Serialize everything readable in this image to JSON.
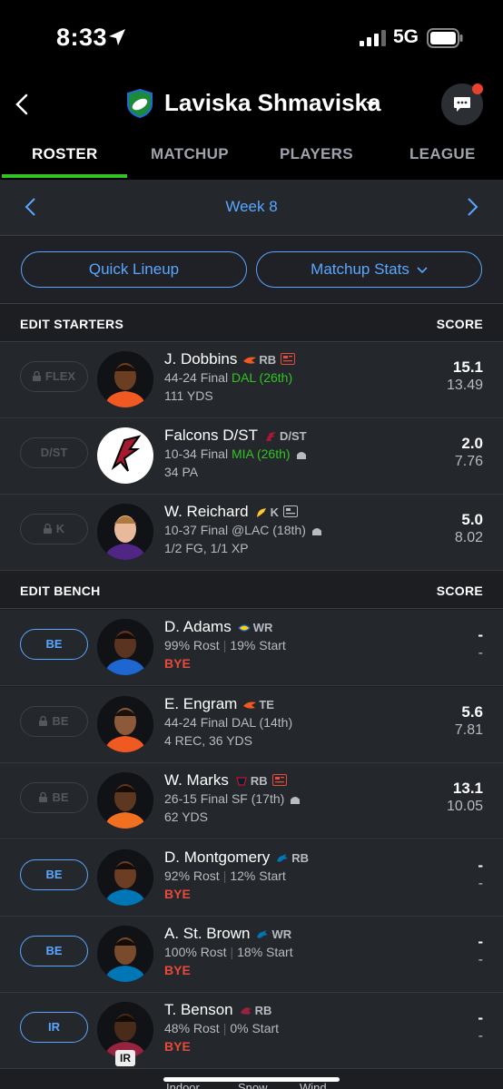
{
  "status": {
    "time": "8:33",
    "network": "5G"
  },
  "header": {
    "team_name": "Laviska Shmaviska"
  },
  "tabs": [
    "ROSTER",
    "MATCHUP",
    "PLAYERS",
    "LEAGUE"
  ],
  "week": {
    "label": "Week 8"
  },
  "actions": {
    "quick_lineup": "Quick Lineup",
    "matchup_stats": "Matchup Stats"
  },
  "starters": {
    "title": "EDIT STARTERS",
    "score_label": "SCORE",
    "rows": [
      {
        "slot": "FLEX",
        "name": "J. Dobbins",
        "pos": "RB",
        "rec": "44-24",
        "status": "Final",
        "opp": "DAL (26th)",
        "stat": "111 YDS",
        "pts": "15.1",
        "proj": "13.49"
      },
      {
        "slot": "D/ST",
        "name": "Falcons D/ST",
        "pos": "D/ST",
        "rec": "10-34",
        "status": "Final",
        "opp": "MIA (26th)",
        "stat": "34 PA",
        "pts": "2.0",
        "proj": "7.76"
      },
      {
        "slot": "K",
        "name": "W. Reichard",
        "pos": "K",
        "rec": "10-37",
        "status": "Final",
        "opp": "@LAC (18th)",
        "stat": "1/2 FG, 1/1 XP",
        "pts": "5.0",
        "proj": "8.02"
      }
    ]
  },
  "bench": {
    "title": "EDIT BENCH",
    "score_label": "SCORE",
    "rows": [
      {
        "slot": "BE",
        "name": "D. Adams",
        "pos": "WR",
        "rost": "99% Rost",
        "start": "19% Start",
        "bye": "BYE",
        "pts": "-",
        "proj": "-"
      },
      {
        "slot": "BE",
        "name": "E. Engram",
        "pos": "TE",
        "rec": "44-24",
        "status": "Final",
        "opp": "DAL (14th)",
        "stat": "4 REC, 36 YDS",
        "pts": "5.6",
        "proj": "7.81"
      },
      {
        "slot": "BE",
        "name": "W. Marks",
        "pos": "RB",
        "rec": "26-15",
        "status": "Final",
        "opp": "SF (17th)",
        "stat": "62 YDS",
        "pts": "13.1",
        "proj": "10.05"
      },
      {
        "slot": "BE",
        "name": "D. Montgomery",
        "pos": "RB",
        "rost": "92% Rost",
        "start": "12% Start",
        "bye": "BYE",
        "pts": "-",
        "proj": "-"
      },
      {
        "slot": "BE",
        "name": "A. St. Brown",
        "pos": "WR",
        "rost": "100% Rost",
        "start": "18% Start",
        "bye": "BYE",
        "pts": "-",
        "proj": "-"
      },
      {
        "slot": "IR",
        "name": "T. Benson",
        "pos": "RB",
        "rost": "48% Rost",
        "start": "0% Start",
        "bye": "BYE",
        "pts": "-",
        "proj": "-",
        "badge": "IR"
      }
    ]
  },
  "legend": {
    "indoor": "Indoor",
    "snow": "Snow",
    "wind": "Wind"
  },
  "colors": {
    "accent": "#5aa7ff",
    "green": "#34c324",
    "bye_red": "#e64a3a",
    "background": "#1c1e22"
  }
}
